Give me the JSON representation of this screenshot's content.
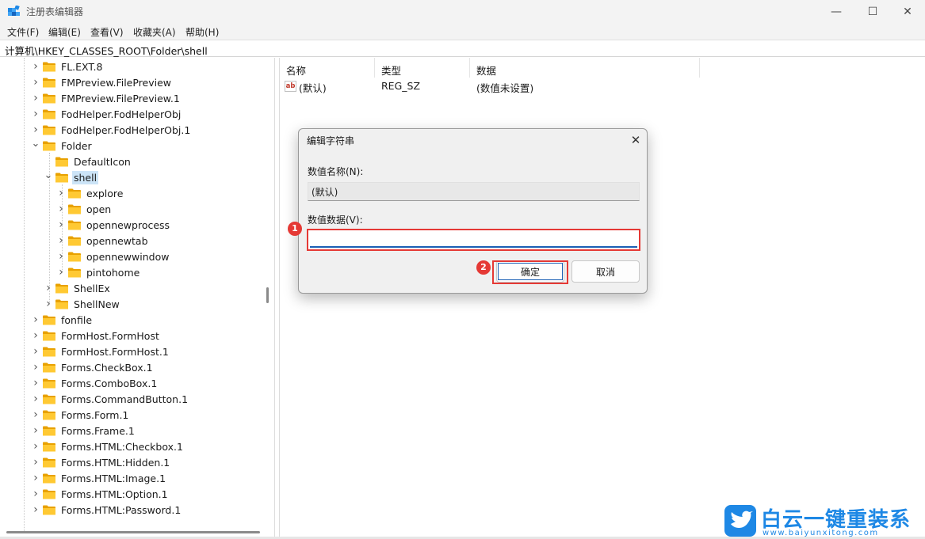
{
  "window": {
    "title": "注册表编辑器",
    "controls": {
      "minimize": "—",
      "maximize": "☐",
      "close": "✕"
    }
  },
  "menu": {
    "items": [
      "文件(F)",
      "编辑(E)",
      "查看(V)",
      "收藏夹(A)",
      "帮助(H)"
    ]
  },
  "address": {
    "path": "计算机\\HKEY_CLASSES_ROOT\\Folder\\shell"
  },
  "tree": {
    "items": [
      {
        "label": "FL.EXT.8",
        "level": 0,
        "expanded": false
      },
      {
        "label": "FMPreview.FilePreview",
        "level": 0,
        "expanded": false
      },
      {
        "label": "FMPreview.FilePreview.1",
        "level": 0,
        "expanded": false
      },
      {
        "label": "FodHelper.FodHelperObj",
        "level": 0,
        "expanded": false
      },
      {
        "label": "FodHelper.FodHelperObj.1",
        "level": 0,
        "expanded": false
      },
      {
        "label": "Folder",
        "level": 0,
        "expanded": true
      },
      {
        "label": "DefaultIcon",
        "level": 1,
        "expanded": null
      },
      {
        "label": "shell",
        "level": 1,
        "expanded": true,
        "selected": true
      },
      {
        "label": "explore",
        "level": 2,
        "expanded": false
      },
      {
        "label": "open",
        "level": 2,
        "expanded": false
      },
      {
        "label": "opennewprocess",
        "level": 2,
        "expanded": false
      },
      {
        "label": "opennewtab",
        "level": 2,
        "expanded": false
      },
      {
        "label": "opennewwindow",
        "level": 2,
        "expanded": false
      },
      {
        "label": "pintohome",
        "level": 2,
        "expanded": false
      },
      {
        "label": "ShellEx",
        "level": 1,
        "expanded": false
      },
      {
        "label": "ShellNew",
        "level": 1,
        "expanded": false
      },
      {
        "label": "fonfile",
        "level": 0,
        "expanded": false
      },
      {
        "label": "FormHost.FormHost",
        "level": 0,
        "expanded": false
      },
      {
        "label": "FormHost.FormHost.1",
        "level": 0,
        "expanded": false
      },
      {
        "label": "Forms.CheckBox.1",
        "level": 0,
        "expanded": false
      },
      {
        "label": "Forms.ComboBox.1",
        "level": 0,
        "expanded": false
      },
      {
        "label": "Forms.CommandButton.1",
        "level": 0,
        "expanded": false
      },
      {
        "label": "Forms.Form.1",
        "level": 0,
        "expanded": false
      },
      {
        "label": "Forms.Frame.1",
        "level": 0,
        "expanded": false
      },
      {
        "label": "Forms.HTML:Checkbox.1",
        "level": 0,
        "expanded": false
      },
      {
        "label": "Forms.HTML:Hidden.1",
        "level": 0,
        "expanded": false
      },
      {
        "label": "Forms.HTML:Image.1",
        "level": 0,
        "expanded": false
      },
      {
        "label": "Forms.HTML:Option.1",
        "level": 0,
        "expanded": false
      },
      {
        "label": "Forms.HTML:Password.1",
        "level": 0,
        "expanded": false
      }
    ]
  },
  "list": {
    "columns": [
      "名称",
      "类型",
      "数据"
    ],
    "rows": [
      {
        "name": "(默认)",
        "type": "REG_SZ",
        "data": "(数值未设置)",
        "icon": "string-value-icon",
        "icon_text": "ab"
      }
    ]
  },
  "dialog": {
    "title": "编辑字符串",
    "close": "✕",
    "name_label": "数值名称(N):",
    "name_value": "(默认)",
    "data_label": "数值数据(V):",
    "data_value": "",
    "ok": "确定",
    "cancel": "取消",
    "badge1": "1",
    "badge2": "2",
    "highlight_color": "#e53935"
  },
  "watermark": {
    "title": "白云一键重装系统",
    "url": "www.baiyunxitong.com",
    "logo_icon": "bird-icon"
  }
}
